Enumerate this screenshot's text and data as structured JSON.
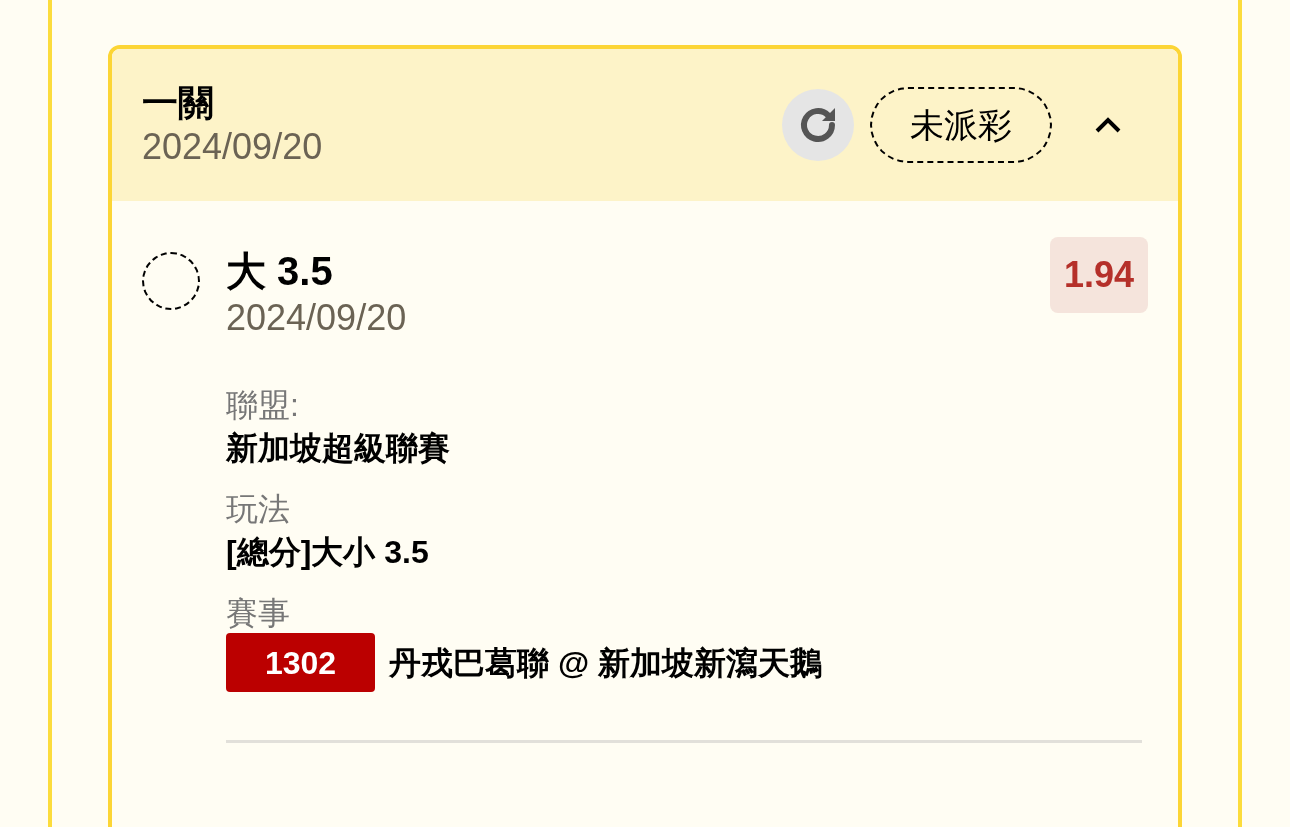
{
  "card": {
    "title": "一關",
    "date": "2024/09/20",
    "status": "未派彩",
    "expanded": true,
    "selection": {
      "name": "大 3.5",
      "date": "2024/09/20",
      "odds": "1.94",
      "checked": false,
      "details": [
        {
          "label": "聯盟:",
          "value": "新加坡超級聯賽"
        },
        {
          "label": "玩法",
          "value": "[總分]大小 3.5"
        },
        {
          "label": "賽事",
          "match_id": "1302",
          "value": "丹戎巴葛聯 @ 新加坡新瀉天鵝"
        }
      ]
    }
  }
}
